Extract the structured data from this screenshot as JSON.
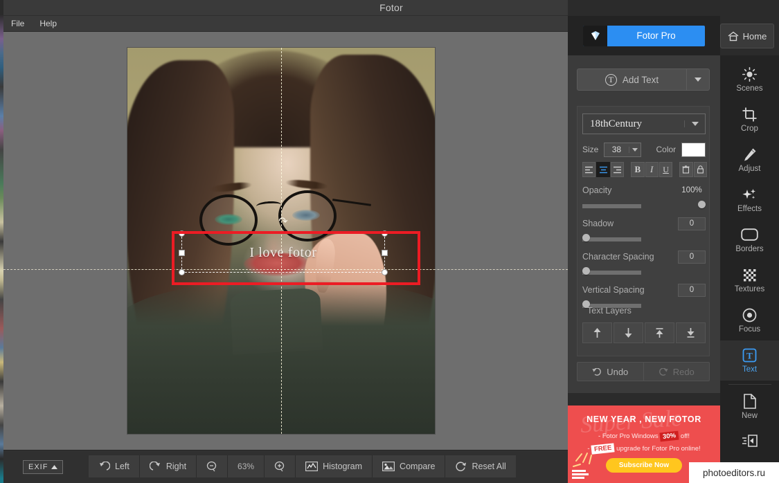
{
  "window": {
    "title": "Fotor",
    "controls": {
      "minimize": "minimize-button",
      "maximize": "maximize-button",
      "close": "close-button"
    }
  },
  "menubar": {
    "items": [
      {
        "label": "File"
      },
      {
        "label": "Help"
      }
    ]
  },
  "header": {
    "pro_label": "Fotor Pro",
    "home_label": "Home",
    "pro_color": "#2c8ef2"
  },
  "text_panel": {
    "add_text_label": "Add Text",
    "font_name": "18thCentury",
    "size_label": "Size",
    "size_value": "38",
    "color_label": "Color",
    "color_value": "#ffffff",
    "style_buttons": [
      {
        "name": "align-left",
        "glyph": ""
      },
      {
        "name": "align-center",
        "glyph": ""
      },
      {
        "name": "align-right",
        "glyph": ""
      },
      {
        "name": "bold",
        "glyph": "B"
      },
      {
        "name": "italic",
        "glyph": "I"
      },
      {
        "name": "underline",
        "glyph": "U"
      },
      {
        "name": "delete",
        "glyph": ""
      },
      {
        "name": "lock",
        "glyph": ""
      }
    ],
    "opacity_label": "Opacity",
    "opacity_value": "100%",
    "shadow_label": "Shadow",
    "shadow_value": "0",
    "char_spacing_label": "Character Spacing",
    "char_spacing_value": "0",
    "vert_spacing_label": "Vertical Spacing",
    "vert_spacing_value": "0",
    "text_layers_label": "Text Layers",
    "undo_label": "Undo",
    "redo_label": "Redo"
  },
  "rail": {
    "items": [
      {
        "label": "Scenes",
        "icon": "sun-icon",
        "active": false
      },
      {
        "label": "Crop",
        "icon": "crop-icon",
        "active": false
      },
      {
        "label": "Adjust",
        "icon": "pencil-icon",
        "active": false
      },
      {
        "label": "Effects",
        "icon": "sparkle-icon",
        "active": false
      },
      {
        "label": "Borders",
        "icon": "rounded-rect-icon",
        "active": false
      },
      {
        "label": "Textures",
        "icon": "checker-icon",
        "active": false
      },
      {
        "label": "Focus",
        "icon": "target-icon",
        "active": false
      },
      {
        "label": "Text",
        "icon": "text-t-icon",
        "active": true
      },
      {
        "label": "New",
        "icon": "page-icon",
        "active": false
      }
    ],
    "export_icon": "export-icon"
  },
  "canvas": {
    "text_object": "I love fotor"
  },
  "bottombar": {
    "exif_label": "EXIF",
    "buttons": [
      {
        "label": "Left",
        "icon": "rotate-left-icon"
      },
      {
        "label": "Right",
        "icon": "rotate-right-icon"
      },
      {
        "label": "",
        "icon": "zoom-out-icon"
      },
      {
        "label": "63%",
        "icon": ""
      },
      {
        "label": "",
        "icon": "zoom-in-icon"
      },
      {
        "label": "Histogram",
        "icon": "histogram-icon"
      },
      {
        "label": "Compare",
        "icon": "compare-icon"
      },
      {
        "label": "Reset  All",
        "icon": "reset-icon"
      }
    ]
  },
  "promo": {
    "script_text": "Super Sale",
    "headline": "NEW YEAR , NEW FOTOR",
    "line1_pre": "- Fotor Pro Windows",
    "line1_tag": "30%",
    "line1_post": "off!",
    "line2_tag": "FREE",
    "line2_pre": "-",
    "line2_post": "upgrade for Fotor Pro online!",
    "cta": "Subscribe Now",
    "bg_color": "#ee4e4e"
  },
  "watermark": {
    "text": "photoeditors.ru"
  }
}
